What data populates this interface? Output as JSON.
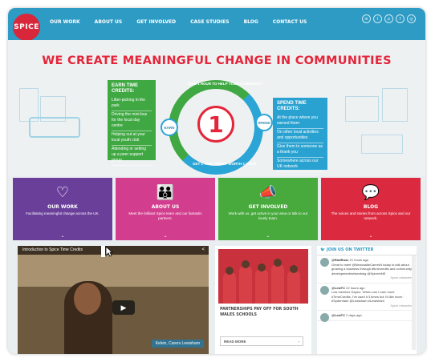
{
  "nav": {
    "logo": "SPICE",
    "links": [
      "OUR WORK",
      "ABOUT US",
      "GET INVOLVED",
      "CASE STUDIES",
      "BLOG",
      "CONTACT US"
    ],
    "social_icons": [
      "linkedin-icon",
      "twitter-icon",
      "pinterest-icon",
      "facebook-icon",
      "instagram-icon"
    ]
  },
  "hero": {
    "headline": "WE CREATE MEANINGFUL CHANGE IN COMMUNITIES",
    "earn": {
      "title": "EARN TIME CREDITS:",
      "items": [
        "Litter-picking in the park",
        "Driving the mini-bus for the local day centre",
        "Helping out at your local youth club",
        "Attending or setting up a peer support group"
      ]
    },
    "spend": {
      "title": "SPEND TIME CREDITS:",
      "items": [
        "At the place where you earned them",
        "On other local activities and opportunities",
        "Give them to someone as a thank you",
        "Somewhere across our UK network"
      ]
    },
    "ring_top": "GIVE 1 HOUR TO HELP YOUR COMMUNITY",
    "ring_bottom": "GET 1 TIME CREDIT WORTH 1 HOUR",
    "earn_node": "EARN",
    "spend_node": "SPEND",
    "center": "1"
  },
  "tiles": [
    {
      "title": "OUR WORK",
      "desc": "Facilitating meaningful change across the UK.",
      "color": "#6a3f9a",
      "icon": "heart-hands-icon",
      "glyph": "♡"
    },
    {
      "title": "ABOUT US",
      "desc": "Meet the brilliant Spice team and our fantastic partners.",
      "color": "#d23d8d",
      "icon": "people-icon",
      "glyph": "👪"
    },
    {
      "title": "GET INVOLVED",
      "desc": "Work with us, get active in your area or talk to our lovely team.",
      "color": "#48a93d",
      "icon": "megaphone-icon",
      "glyph": "📣"
    },
    {
      "title": "BLOG",
      "desc": "The voices and stories from across Spice and our network.",
      "color": "#db2a40",
      "icon": "speech-bubbles-icon",
      "glyph": "💬"
    }
  ],
  "video": {
    "title": "Introduction to Spice Time Credits",
    "caption": "Kelvin, Carers Lewisham"
  },
  "news": {
    "headline": "PARTNERSHIPS PAY OFF FOR SOUTH WALES SCHOOLS",
    "more": "READ MORE"
  },
  "twitter": {
    "header": "JOIN US ON TWITTER",
    "tweets": [
      {
        "handle": "@RobRose",
        "time": "21 hours ago",
        "text": "Great to meet @NewcastleCarersN today to talk about growing a business through #timecredits and community development/networking @SpiceInNE"
      },
      {
        "handle": "@LewTC",
        "time": "22 hours ago",
        "text": "Lois member Gaylor: 'When can I earn more #TimeCredits, I've used it 3 times but I'd like more.' #Sydenham @Lewisham #Lewisham"
      },
      {
        "handle": "@LewTC",
        "time": "2 days ago",
        "text": ""
      }
    ],
    "follow": "Spice retweeted"
  }
}
